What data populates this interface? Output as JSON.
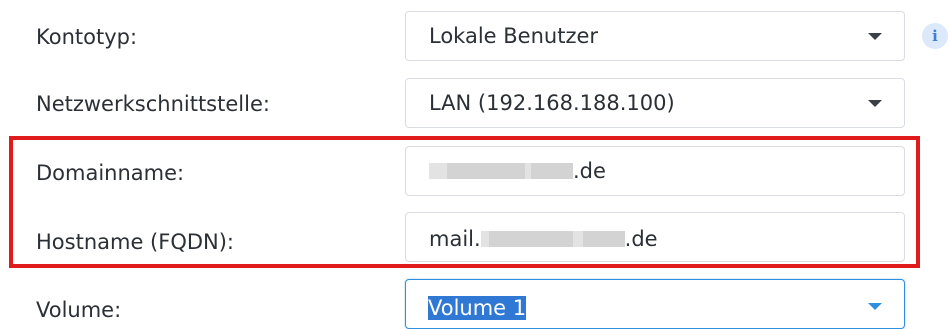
{
  "form": {
    "account_type": {
      "label": "Kontotyp:",
      "value": "Lokale Benutzer",
      "info_icon": "info-icon",
      "info_glyph": "i"
    },
    "network_interface": {
      "label": "Netzwerkschnittstelle:",
      "value": "LAN (192.168.188.100)"
    },
    "domain_name": {
      "label": "Domainname:",
      "value_suffix": ".de"
    },
    "hostname": {
      "label": "Hostname (FQDN):",
      "value_prefix": "mail.",
      "value_suffix": ".de"
    },
    "volume": {
      "label": "Volume:",
      "value": "Volume 1"
    }
  },
  "colors": {
    "highlight_border": "#e01b1b",
    "focus_accent": "#2f8fe0",
    "selection": "#2f78d4"
  }
}
